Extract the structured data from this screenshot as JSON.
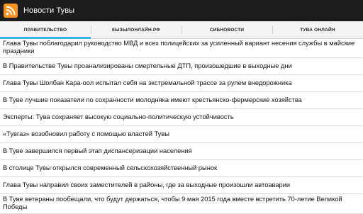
{
  "app": {
    "title": "Новости Тувы",
    "icon": "rss-icon",
    "icon_color": "#f7931e"
  },
  "colors": {
    "actionbar": "#1c1c1c",
    "tab_indicator": "#33b5e5"
  },
  "tabs": [
    {
      "label": "ПРАВИТЕЛЬСТВО",
      "active": true
    },
    {
      "label": "КЫЗЫЛОНЛАЙН.РФ",
      "active": false
    },
    {
      "label": "СИБНОВОСТИ",
      "active": false
    },
    {
      "label": "ТУВА ОНЛАЙН",
      "active": false
    }
  ],
  "news": [
    "Глава Тувы поблагодарил руководство МВД и всех полицейских за усиленный вариант несения службы в майские праздники",
    "В Правительстве Тувы проанализированы смертельные ДТП, произошедшие в выходные дни",
    "Глава Тувы Шолбан Кара-оол испытал себя на экстремальной трассе за рулем внедорожника",
    "В Туве  лучшие показатели по сохранности молодняка имеют  крестьянско-фермерские хозяйства",
    "Эксперты: Тува сохраняет высокую социально-политическую устойчивость",
    "«Тувгаз» возобновил работу с помощью  властей Тувы",
    "В Туве завершился первый этап диспансеризации населения",
    "В столице Тувы открылся современный  сельскохозяйственный рынок",
    "Глава Тувы направил своих заместителей в районы, где за выходные произошли  автоаварии",
    "В Туве ветераны пообещали,  что  будут держаться, чтобы 9 мая 2015 года вместе встретить 70-летие Великой Победы"
  ]
}
